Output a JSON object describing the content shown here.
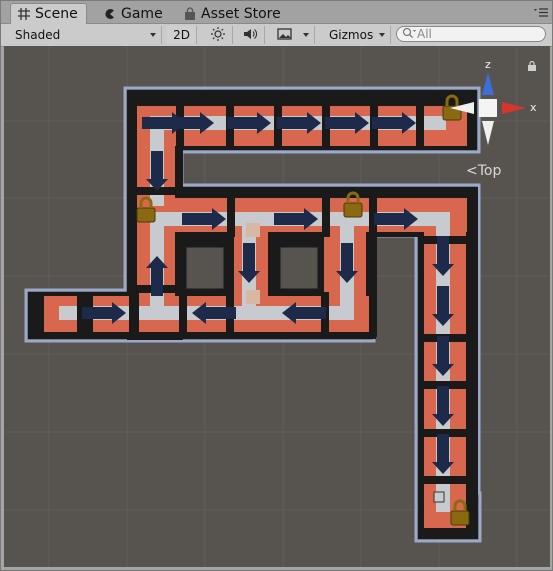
{
  "tabs": [
    {
      "label": "Scene",
      "icon": "grid-icon",
      "active": true
    },
    {
      "label": "Game",
      "icon": "pacman-icon",
      "active": false
    },
    {
      "label": "Asset Store",
      "icon": "shopping-bag-icon",
      "active": false
    }
  ],
  "toolbar": {
    "shading_mode": "Shaded",
    "mode_2d": "2D",
    "gizmos_label": "Gizmos",
    "search_placeholder": "All"
  },
  "gizmo": {
    "view_label": "Top",
    "z_label": "z",
    "x_label": "x"
  },
  "colors": {
    "viewport_bg": "#575450",
    "wall": "#1a1a1a",
    "floor": "#d7684e",
    "track": "#c7cbd0",
    "arrow": "#1e2a4a",
    "lock": "#8a6a10",
    "outline": "#9aa9c7"
  }
}
